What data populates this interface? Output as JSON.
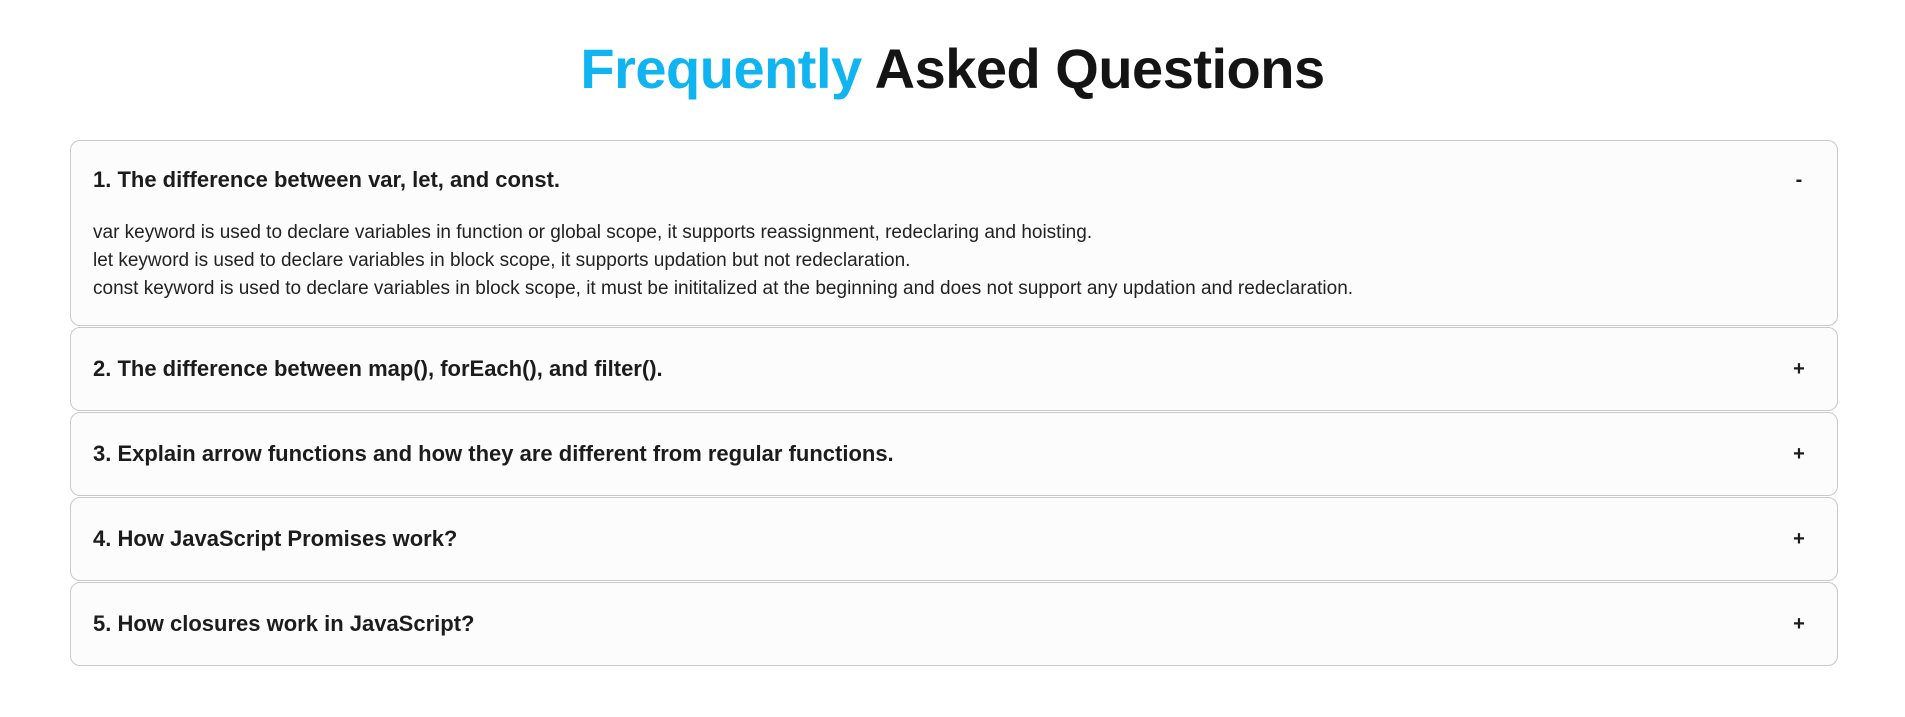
{
  "heading": {
    "accent": "Frequently",
    "rest": "Asked Questions",
    "accent_color": "#0fb4f0"
  },
  "faq": [
    {
      "question": "1. The difference between var, let, and const.",
      "toggle": "-",
      "open": true,
      "answer": [
        "var keyword is used to declare variables in function or global scope, it supports reassignment, redeclaring and hoisting.",
        "let keyword is used to declare variables in block scope, it supports updation but not redeclaration.",
        "const keyword is used to declare variables in block scope, it must be inititalized at the beginning and does not support any updation and redeclaration."
      ]
    },
    {
      "question": "2. The difference between map(), forEach(), and filter().",
      "toggle": "+",
      "open": false
    },
    {
      "question": "3. Explain arrow functions and how they are different from regular functions.",
      "toggle": "+",
      "open": false
    },
    {
      "question": "4. How JavaScript Promises work?",
      "toggle": "+",
      "open": false
    },
    {
      "question": "5. How closures work in JavaScript?",
      "toggle": "+",
      "open": false
    }
  ]
}
